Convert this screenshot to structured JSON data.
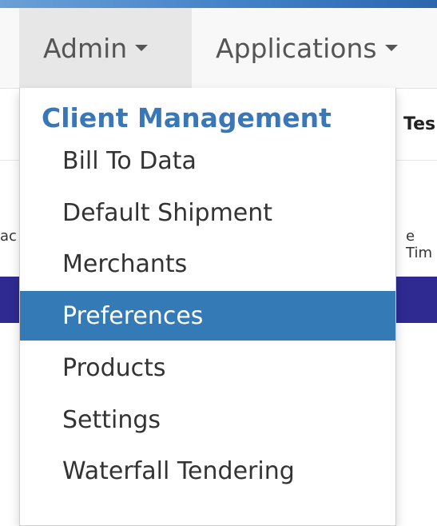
{
  "navbar": {
    "admin_label": "Admin",
    "applications_label": "Applications"
  },
  "background": {
    "tab_fragment": "Tes",
    "left_fragment": "ac",
    "right_fragment": "e Tim"
  },
  "dropdown": {
    "header": "Client Management",
    "items": [
      {
        "label": "Bill To Data"
      },
      {
        "label": "Default Shipment"
      },
      {
        "label": "Merchants"
      },
      {
        "label": "Preferences",
        "active": true
      },
      {
        "label": "Products"
      },
      {
        "label": "Settings"
      },
      {
        "label": "Waterfall Tendering"
      }
    ]
  },
  "colors": {
    "accent": "#337ab7",
    "header_text": "#3a77b7",
    "band": "#2f2a91"
  }
}
